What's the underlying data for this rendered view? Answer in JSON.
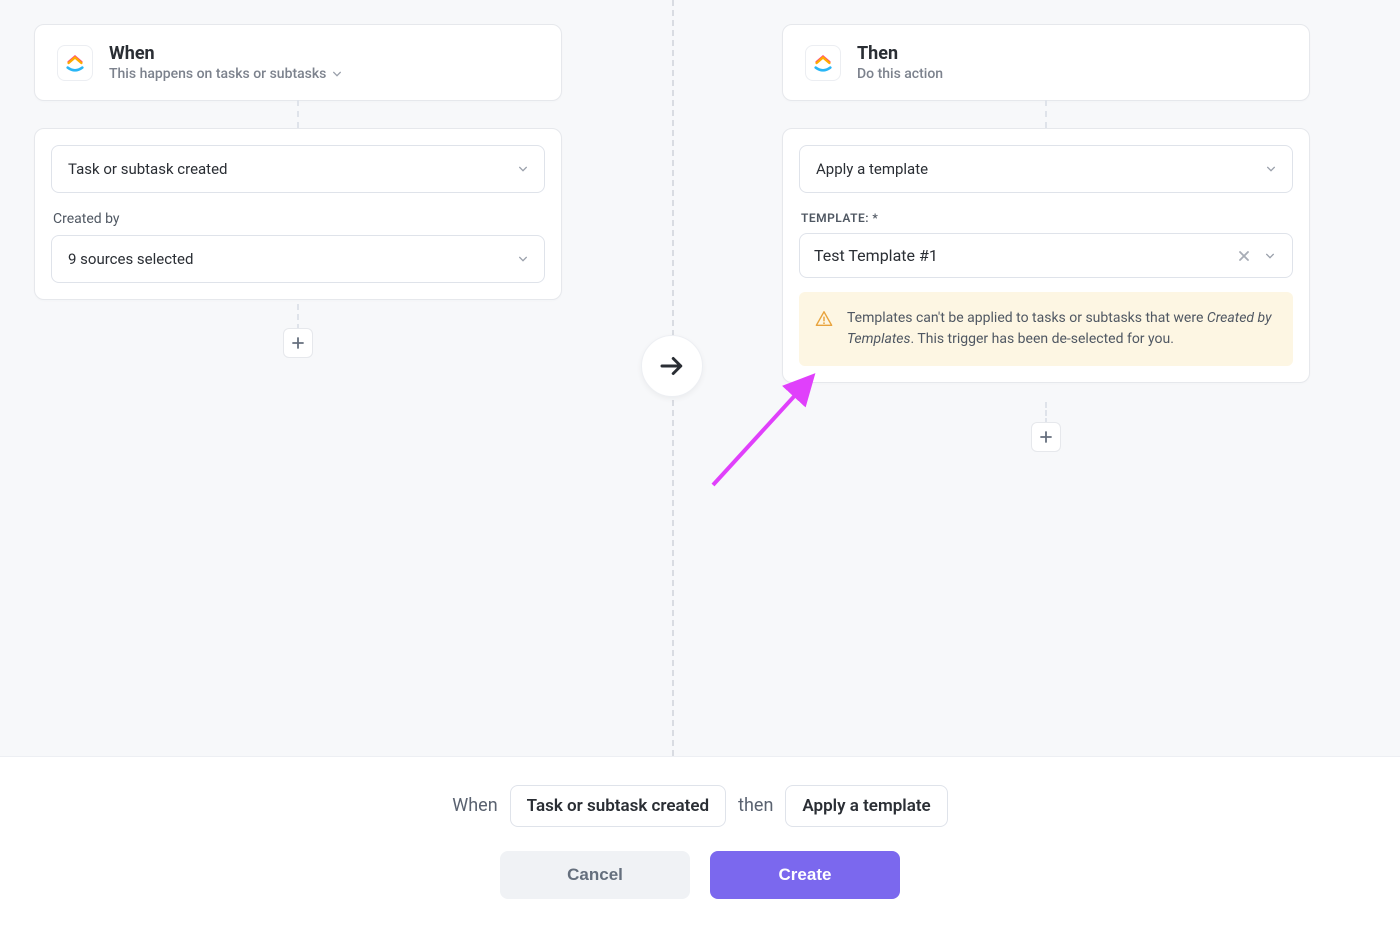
{
  "when": {
    "title": "When",
    "subtitle": "This happens on tasks or subtasks",
    "trigger_select": "Task or subtask created",
    "created_by_label": "Created by",
    "created_by_value": "9 sources selected"
  },
  "then": {
    "title": "Then",
    "subtitle": "Do this action",
    "action_select": "Apply a template",
    "template_label": "TEMPLATE: *",
    "template_value": "Test Template #1",
    "warning_before": "Templates can't be applied to tasks or subtasks that were ",
    "warning_italic": "Created by Templates",
    "warning_after": ". This trigger has been de-selected for you."
  },
  "footer": {
    "when_text": "When",
    "when_pill": "Task or subtask created",
    "then_text": "then",
    "then_pill": "Apply a template",
    "cancel": "Cancel",
    "create": "Create"
  }
}
